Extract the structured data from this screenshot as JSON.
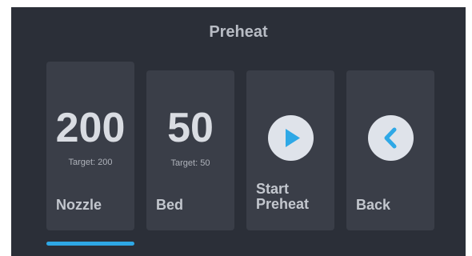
{
  "screen": {
    "title": "Preheat"
  },
  "cards": {
    "nozzle": {
      "value": "200",
      "target": "Target: 200",
      "label": "Nozzle"
    },
    "bed": {
      "value": "50",
      "target": "Target: 50",
      "label": "Bed"
    },
    "start": {
      "label_line1": "Start",
      "label_line2": "Preheat",
      "icon": "play-icon"
    },
    "back": {
      "label": "Back",
      "icon": "chevron-left-icon"
    }
  },
  "colors": {
    "background": "#2b2f38",
    "card": "#3a3e48",
    "accent": "#2ea8e6",
    "icon_circle": "#dfe3ea",
    "text_primary": "#d9dce2",
    "text_secondary": "#aeb2ba"
  },
  "indicator": {
    "active": "nozzle"
  }
}
